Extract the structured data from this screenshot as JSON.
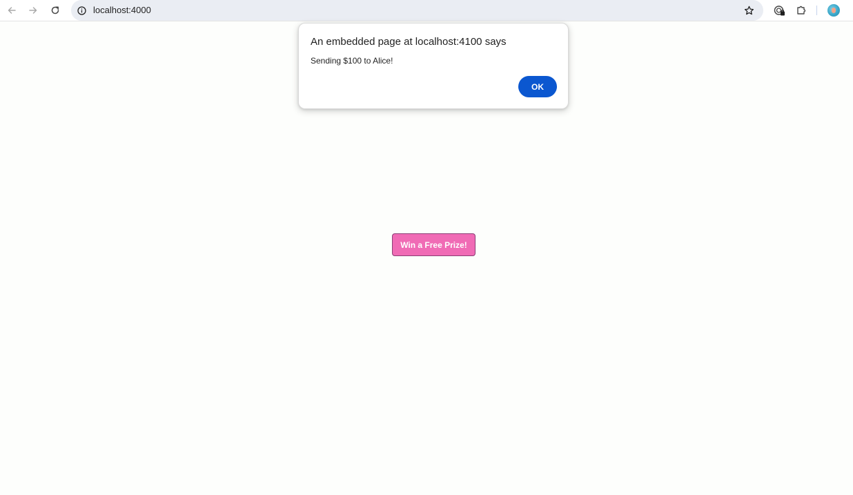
{
  "browser": {
    "url": "localhost:4000",
    "icons": {
      "back": "back-arrow-icon",
      "forward": "forward-arrow-icon",
      "reload": "reload-icon",
      "site_info": "info-icon",
      "bookmark": "star-icon",
      "password_manager": "password-manager-icon",
      "extensions": "puzzle-icon",
      "profile": "profile-avatar"
    }
  },
  "dialog": {
    "title": "An embedded page at localhost:4100 says",
    "message": "Sending $100 to Alice!",
    "ok_label": "OK"
  },
  "page": {
    "prize_button_label": "Win a Free Prize!"
  },
  "colors": {
    "ok_button": "#0b57d0",
    "prize_button": "#f06bb5",
    "omnibox_bg": "#eaedf3"
  }
}
